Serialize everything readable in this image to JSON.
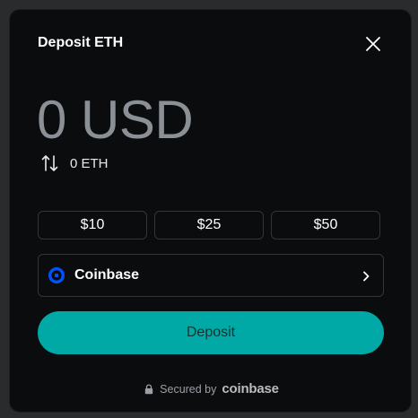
{
  "modal": {
    "title": "Deposit ETH",
    "close_icon": "close-icon"
  },
  "amount": {
    "fiat": "0 USD",
    "crypto": "0 ETH",
    "swap_icon": "swap-arrows-icon"
  },
  "presets": [
    "$10",
    "$25",
    "$50"
  ],
  "provider": {
    "name": "Coinbase",
    "logo_icon": "coinbase-logo-icon",
    "chevron_icon": "chevron-right-icon"
  },
  "deposit_button": "Deposit",
  "footer": {
    "secured_by": "Secured by",
    "brand": "coinbase",
    "lock_icon": "lock-icon"
  },
  "colors": {
    "accent": "#00a9a6",
    "background": "#0b0c0d",
    "border": "#33353a",
    "coinbase_blue": "#0052ff"
  }
}
